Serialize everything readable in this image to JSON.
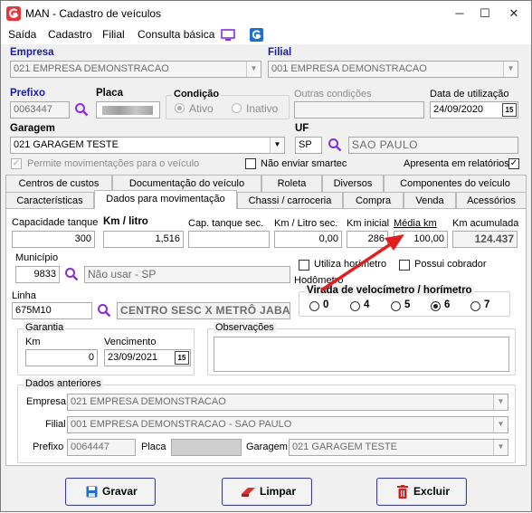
{
  "window": {
    "title": "MAN - Cadastro de veículos",
    "min": "─",
    "max": "☐",
    "close": "✕"
  },
  "menu": {
    "items": [
      "Saída",
      "Cadastro",
      "Filial",
      "Consulta básica"
    ]
  },
  "header": {
    "empresa_label": "Empresa",
    "empresa_value": "021 EMPRESA DEMONSTRACAO",
    "filial_label": "Filial",
    "filial_value": "001 EMPRESA DEMONSTRACAO",
    "prefixo_label": "Prefixo",
    "prefixo_value": "0063447",
    "placa_label": "Placa",
    "condicao_label": "Condição",
    "ativo_label": "Ativo",
    "inativo_label": "Inativo",
    "outras_label": "Outras condições",
    "outras_value": "",
    "data_label": "Data de utilização",
    "data_value": "24/09/2020",
    "cal_btn": "15",
    "garagem_label": "Garagem",
    "garagem_value": "021 GARAGEM TESTE",
    "uf_label": "UF",
    "uf_value": "SP",
    "uf_name": "SAO PAULO",
    "permite_label": "Permite movimentações para o veículo",
    "permite_checked": "✓",
    "nao_enviar_label": "Não enviar smartec",
    "apresenta_label": "Apresenta em relatórios",
    "apresenta_checked": "✓"
  },
  "tabs_row1": [
    "Centros de custos",
    "Documentação do veículo",
    "Roleta",
    "Diversos",
    "Componentes do veículo"
  ],
  "tabs_row2": [
    "Características",
    "Dados para movimentação",
    "Chassi / carroceria",
    "Compra",
    "Venda",
    "Acessórios"
  ],
  "mov": {
    "cap_label": "Capacidade tanque",
    "cap_value": "300",
    "kml_label": "Km / litro",
    "kml_value": "1,516",
    "capsec_label": "Cap. tanque sec.",
    "capsec_value": "",
    "kmlsec_label": "Km / Litro sec.",
    "kmlsec_value": "0,00",
    "kmini_label": "Km inicial",
    "kmini_value": "286",
    "media_label": "Média km",
    "media_value": "100,00",
    "kmacum_label": "Km acumulada",
    "kmacum_value": "124.437",
    "municipio_label": "Município",
    "municipio_code": "9833",
    "municipio_name": "Não usar  - SP",
    "utiliza_label": "Utiliza horímetro",
    "possui_label": "Possui cobrador",
    "hodometro_label": "Hodômetro",
    "virada_label": "Virada de velocímetro / horímetro",
    "virada_options": [
      "0",
      "4",
      "5",
      "6",
      "7"
    ],
    "linha_label": "Linha",
    "linha_code": "675M10",
    "linha_name": "CENTRO SESC X METRÔ JABAQ",
    "garantia_label": "Garantia",
    "km_label": "Km",
    "km_value": "0",
    "venc_label": "Vencimento",
    "venc_value": "23/09/2021",
    "cal_btn": "15",
    "obs_label": "Observações",
    "obs_value": "",
    "ant_label": "Dados anteriores",
    "ant_empresa_label": "Empresa",
    "ant_empresa_value": "021 EMPRESA DEMONSTRACAO",
    "ant_filial_label": "Filial",
    "ant_filial_value": "001 EMPRESA DEMONSTRACAO - SAO PAULO",
    "ant_prefixo_label": "Prefixo",
    "ant_prefixo_value": "0064447",
    "ant_placa_label": "Placa",
    "ant_garagem_label": "Garagem",
    "ant_garagem_value": "021 GARAGEM TESTE"
  },
  "buttons": {
    "gravar": "Gravar",
    "limpar": "Limpar",
    "excluir": "Excluir"
  },
  "colors": {
    "accent_blue": "#1a1aa8",
    "arrow_red": "#e02020",
    "purple_icon": "#8a2be2"
  }
}
